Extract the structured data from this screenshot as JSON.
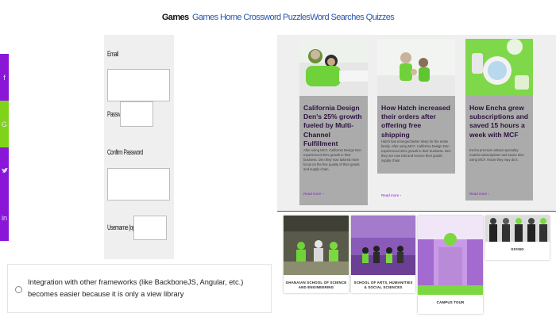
{
  "nav": {
    "items": [
      "Games",
      "Games",
      "Home",
      "Crossword Puzzles",
      "Word Searches",
      "Quizzes"
    ]
  },
  "social": {
    "icons": [
      "facebook-icon",
      "google-plus-icon",
      "twitter-icon",
      "linkedin-icon"
    ],
    "colors": {
      "purple": "#8a16d8",
      "green": "#7fd41a"
    }
  },
  "form": {
    "email_label": "Email",
    "password_label": "Password",
    "confirm_label": "Confirm Password",
    "username_label": "Username (optional)"
  },
  "option": {
    "text": "Integration with other frameworks (like BackboneJS, Angular, etc.) becomes easier because it is only a view library"
  },
  "cases": [
    {
      "title": "California Design Den's 25% growth fueled by Multi-Channel Fulfillment",
      "body": "After using MCF, California Design Den experienced 25% growth in their business. Den they now tailored more focus on the fine quality of their goods and supply chain.",
      "more": "Read more ›"
    },
    {
      "title": "How Hatch increased their orders after offering free shipping",
      "body": "Hatch has emerged better sleep for the entire family. After using MCF, California Design Den experienced 25% growth in their business. Den they are now told and receive their goods supply chain.",
      "more": "Read more ›"
    },
    {
      "title": "How Encha grew subscriptions and saved 15 hours a week with MCF",
      "body": "Encha premium artisan speciality matcha subscriptions and saves time using MCF. Hours they may do it.",
      "more": "Read more ›"
    }
  ],
  "schools": [
    {
      "caption": "GHANAIAN SCHOOL OF SCIENCE AND ENGINEERING"
    },
    {
      "caption": "SCHOOL OF ARTS, HUMANITIES & SOCIAL SCIENCES"
    },
    {
      "caption": "CAMPUS TOUR"
    },
    {
      "caption": "GIVING"
    }
  ]
}
